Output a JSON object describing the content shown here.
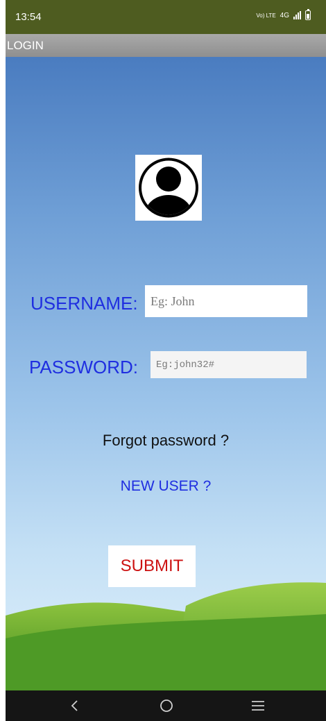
{
  "status_bar": {
    "time": "13:54",
    "lte_label": "Vo) LTE",
    "network": "4G",
    "icons": [
      "lte-icon",
      "signal-icon",
      "battery-icon"
    ]
  },
  "app_bar": {
    "title": "LOGIN"
  },
  "login": {
    "avatar_icon": "user-circle-icon",
    "username_label": "USERNAME:",
    "username_placeholder": "Eg: John",
    "password_label": "PASSWORD:",
    "password_placeholder": "Eg:john32#",
    "forgot_link": "Forgot password ?",
    "new_user_link": "NEW USER ?",
    "submit_label": "SUBMIT"
  },
  "nav_bar": {
    "buttons": [
      "back-icon",
      "home-icon",
      "recents-icon"
    ]
  },
  "colors": {
    "status_bar": "#4e5c20",
    "label_blue": "#1f2ee0",
    "submit_red": "#cc1111",
    "nav_bar": "#151515"
  }
}
